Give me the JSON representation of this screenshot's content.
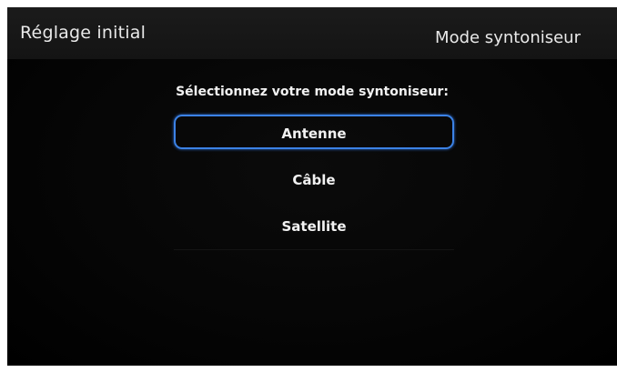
{
  "header": {
    "left_title": "Réglage initial",
    "right_title": "Mode syntoniseur"
  },
  "prompt": "Sélectionnez votre mode syntoniseur:",
  "options": [
    {
      "label": "Antenne",
      "selected": true
    },
    {
      "label": "Câble",
      "selected": false
    },
    {
      "label": "Satellite",
      "selected": false
    }
  ]
}
